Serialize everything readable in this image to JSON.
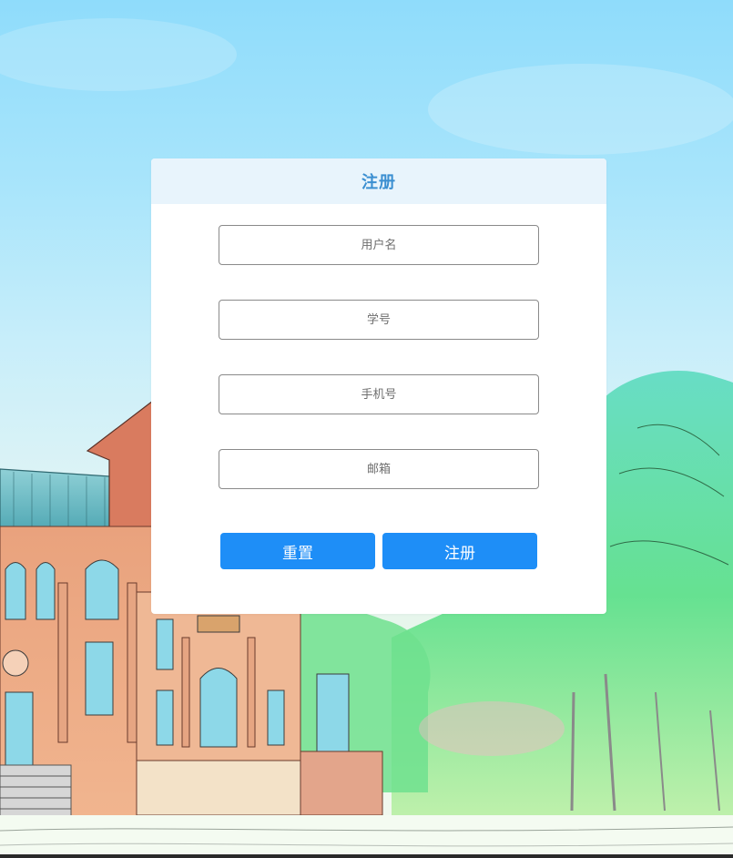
{
  "form": {
    "title": "注册",
    "fields": [
      {
        "name": "username",
        "placeholder": "用户名",
        "value": ""
      },
      {
        "name": "student_id",
        "placeholder": "学号",
        "value": ""
      },
      {
        "name": "phone",
        "placeholder": "手机号",
        "value": ""
      },
      {
        "name": "email",
        "placeholder": "邮箱",
        "value": ""
      }
    ],
    "reset_label": "重置",
    "submit_label": "注册"
  },
  "colors": {
    "accent": "#1e8ef7",
    "title": "#3b8fd1",
    "header_bg": "#e8f4fc",
    "sky": "#8fdcfb"
  },
  "background": {
    "icon": "campus-watercolor-illustration"
  }
}
